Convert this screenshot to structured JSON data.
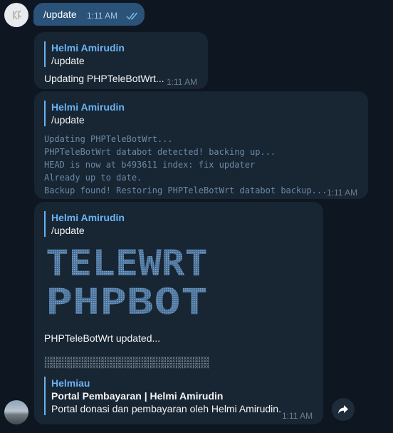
{
  "outgoing": {
    "text": "/update",
    "time": "1:11 AM"
  },
  "messages": [
    {
      "reply_name": "Helmi Amirudin",
      "reply_text": "/update",
      "text": "Updating PHPTeleBotWrt...",
      "time": "1:11 AM"
    },
    {
      "reply_name": "Helmi Amirudin",
      "reply_text": "/update",
      "lines": [
        "Updating PHPTeleBotWrt...",
        "PHPTeleBotWrt databot detected! backing up...",
        "HEAD is now at b493611 index: fix updater",
        "Already up to date.",
        "Backup found! Restoring PHPTeleBotWrt databot backup..."
      ],
      "time": "1:11 AM"
    },
    {
      "reply_name": "Helmi Amirudin",
      "reply_text": "/update",
      "art_lines": [
        "TELEWRT",
        "PHPBOT"
      ],
      "text": "PHPTeleBotWrt updated...",
      "preview": {
        "site": "Helmiau",
        "title": "Portal Pembayaran | Helmi Amirudin",
        "description": "Portal donasi dan pembayaran oleh Helmi Amirudin."
      },
      "time": "1:11 AM"
    }
  ],
  "colors": {
    "background": "#0e1621",
    "incoming": "#182533",
    "outgoing": "#2b5278",
    "accent": "#6ab3f3"
  },
  "icons": {
    "top_avatar": "bot-logo-icon",
    "bottom_avatar": "landscape-avatar",
    "forward": "forward-arrow-icon",
    "read_receipt": "double-check-icon"
  }
}
